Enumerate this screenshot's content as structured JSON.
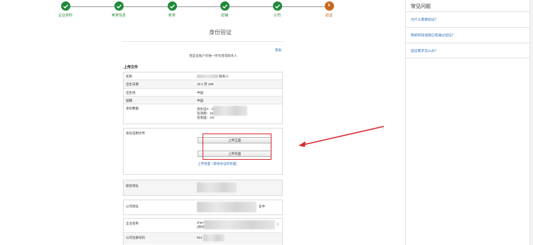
{
  "stepper": {
    "steps": [
      {
        "label": "企业资料",
        "state": "done"
      },
      {
        "label": "卖家信息",
        "state": "done"
      },
      {
        "label": "账单",
        "state": "done"
      },
      {
        "label": "店铺",
        "state": "done"
      },
      {
        "label": "公司",
        "state": "done"
      },
      {
        "label": "验证",
        "state": "current",
        "number": "6"
      }
    ]
  },
  "header": {
    "title": "身份验证",
    "help_link": "帮助",
    "subtitle": "我是该账户的唯一所有者或联系人"
  },
  "upload_section": {
    "heading": "上传文件",
    "rows": [
      {
        "key": "名称",
        "value": "联系人"
      },
      {
        "key": "出生日期",
        "value": "19 2 月 199"
      },
      {
        "key": "出生地",
        "value": "中国"
      },
      {
        "key": "国籍",
        "value": "中国"
      },
      {
        "key": "身份数据",
        "lines": [
          "身份证#：4",
          "有效期：19.2",
          "签发国：CN"
        ]
      }
    ],
    "id_document": {
      "label": "身份证明文件",
      "upload_front": "上传正面",
      "upload_back": "上传背面",
      "hint": "上传背面（即身份证的背面）"
    }
  },
  "address_section": {
    "residential_label": "居住地址",
    "company_label": "公司地址",
    "company_suffix": "业中"
  },
  "company_section": {
    "rows": [
      {
        "key": "企业名称",
        "value": "zhen",
        "value_line2": "(郑州"
      },
      {
        "key": "公司注册号码",
        "value": "914"
      }
    ],
    "trailing_mark": ")"
  },
  "sidebar": {
    "title": "常见问题",
    "faqs": [
      "为什么需要验证？",
      "我如何知道我已经通过验证？",
      "验证需求怎么办？"
    ]
  },
  "colors": {
    "done": "#1f8a3a",
    "current": "#c9661c",
    "link": "#2a6bb3",
    "annotation": "#d9272e"
  }
}
